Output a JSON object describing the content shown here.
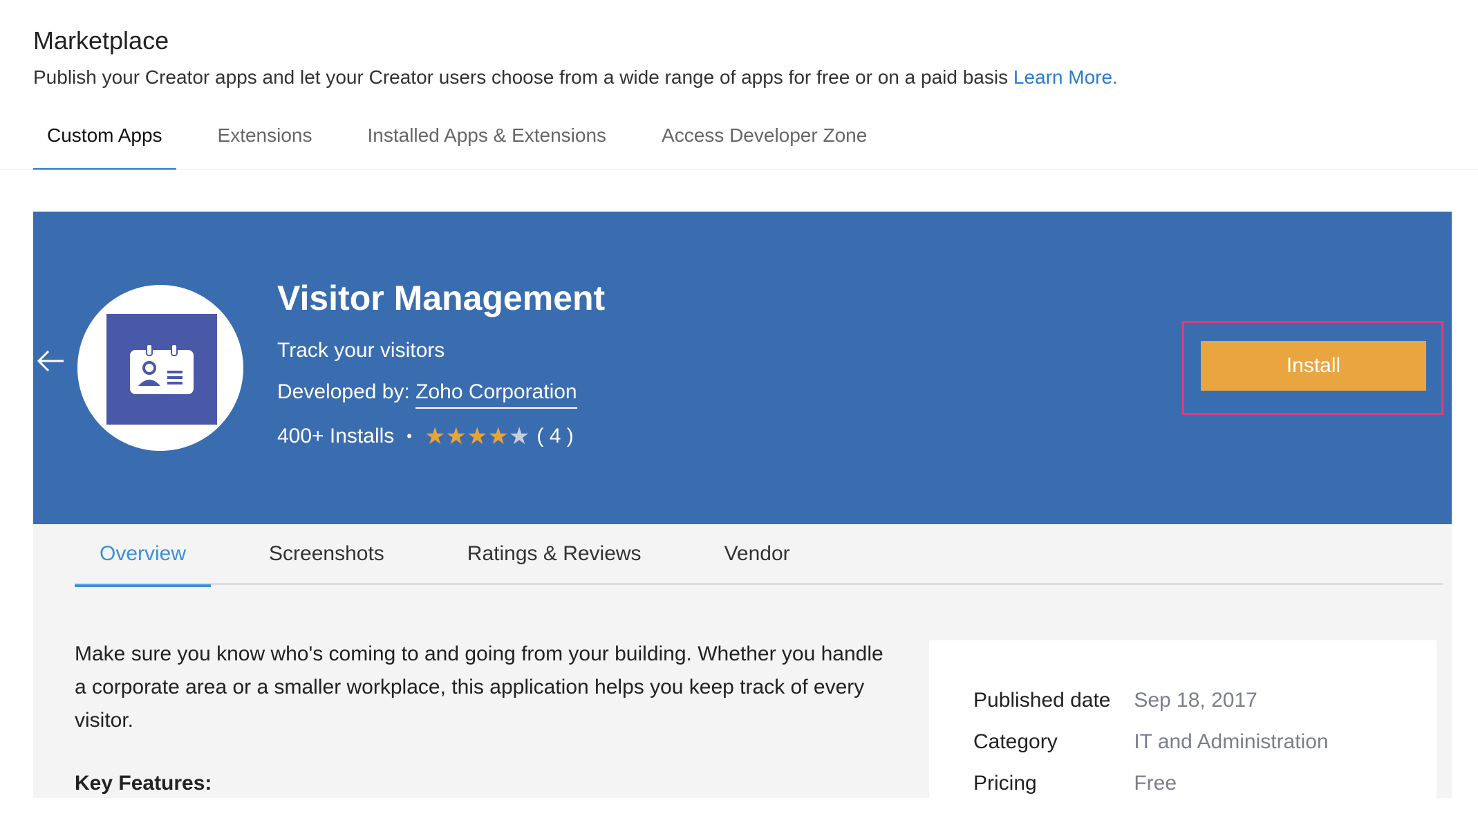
{
  "header": {
    "title": "Marketplace",
    "subtitle": "Publish your Creator apps and let your Creator users choose from a wide range of apps for free or on a paid basis",
    "learn_more": "Learn More."
  },
  "top_tabs": [
    {
      "label": "Custom Apps",
      "active": true
    },
    {
      "label": "Extensions",
      "active": false
    },
    {
      "label": "Installed Apps & Extensions",
      "active": false
    },
    {
      "label": "Access Developer Zone",
      "active": false
    }
  ],
  "app": {
    "name": "Visitor Management",
    "tagline": "Track your visitors",
    "developed_by_label": "Developed by:",
    "developer": "Zoho Corporation",
    "installs": "400+ Installs",
    "rating_stars": 4,
    "rating_max": 5,
    "rating_count": "( 4 )",
    "install_label": "Install",
    "logo_icon": "id-badge-icon"
  },
  "detail_tabs": [
    {
      "label": "Overview",
      "active": true
    },
    {
      "label": "Screenshots",
      "active": false
    },
    {
      "label": "Ratings & Reviews",
      "active": false
    },
    {
      "label": "Vendor",
      "active": false
    }
  ],
  "overview": {
    "description": "Make sure you know who's coming to and going from your building. Whether you handle a corporate area or a smaller workplace, this application helps you keep track of every visitor.",
    "key_features_heading": "Key Features:"
  },
  "info": {
    "published_label": "Published date",
    "published_value": "Sep 18, 2017",
    "category_label": "Category",
    "category_value": "IT and Administration",
    "pricing_label": "Pricing",
    "pricing_value": "Free"
  },
  "colors": {
    "banner": "#3a6db0",
    "accent": "#2b7bd0",
    "install": "#e9a640",
    "highlight": "#e23b73",
    "star": "#e8a43a"
  }
}
